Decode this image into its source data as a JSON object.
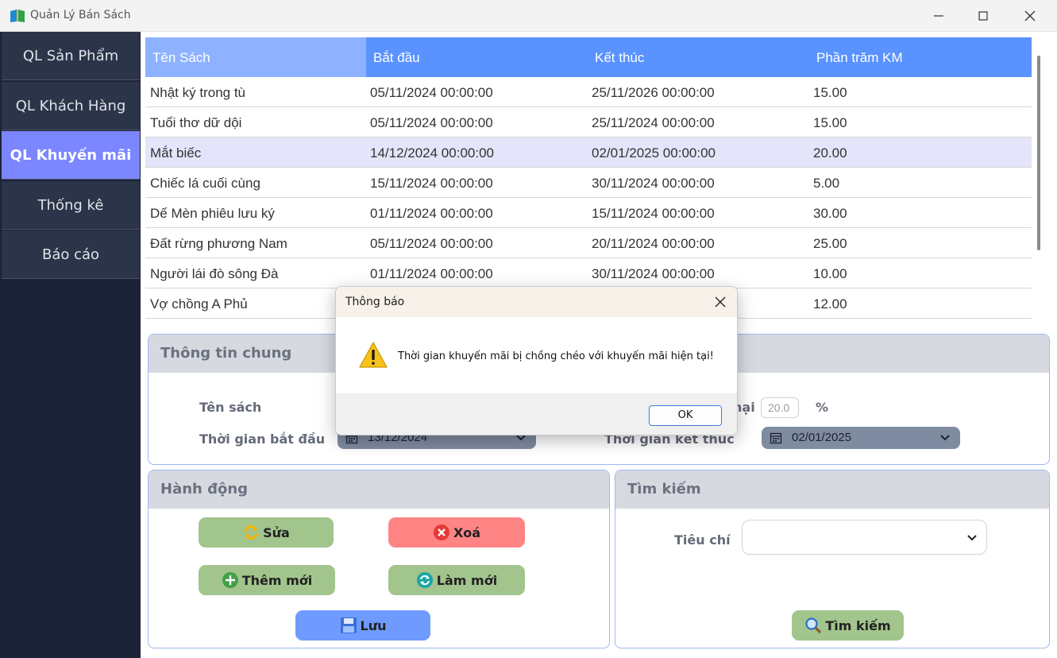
{
  "window": {
    "title": "Quản Lý Bán Sách"
  },
  "sidebar": {
    "items": [
      {
        "label": "QL Sản Phẩm",
        "active": false
      },
      {
        "label": "QL Khách Hàng",
        "active": false
      },
      {
        "label": "QL Khuyến mãi",
        "active": true
      },
      {
        "label": "Thống kê",
        "active": false
      },
      {
        "label": "Báo cáo",
        "active": false
      }
    ]
  },
  "table": {
    "columns": [
      "Tên Sách",
      "Bắt đầu",
      "Kết thúc",
      "Phần trăm KM"
    ],
    "rows": [
      [
        "Nhật ký trong tù",
        "05/11/2024 00:00:00",
        "25/11/2026 00:00:00",
        "15.00"
      ],
      [
        "Tuổi thơ dữ dội",
        "05/11/2024 00:00:00",
        "25/11/2024 00:00:00",
        "15.00"
      ],
      [
        "Mắt biếc",
        "14/12/2024 00:00:00",
        "02/01/2025 00:00:00",
        "20.00"
      ],
      [
        "Chiếc lá cuối cùng",
        "15/11/2024 00:00:00",
        "30/11/2024 00:00:00",
        "5.00"
      ],
      [
        "Dế Mèn phiêu lưu ký",
        "01/11/2024 00:00:00",
        "15/11/2024 00:00:00",
        "30.00"
      ],
      [
        "Đất rừng phương Nam",
        "05/11/2024 00:00:00",
        "20/11/2024 00:00:00",
        "25.00"
      ],
      [
        "Người lái đò sông Đà",
        "01/11/2024 00:00:00",
        "30/11/2024 00:00:00",
        "10.00"
      ],
      [
        "Vợ chồng A Phủ",
        "",
        "",
        "12.00"
      ]
    ],
    "selected_row": 2
  },
  "info": {
    "title": "Thông tin chung",
    "book_label": "Tên sách",
    "start_label": "Thời gian bắt đầu",
    "start_value": "13/12/2024",
    "end_label": "Thời gian kết thúc",
    "end_value": "02/01/2025",
    "discount_label_fragment": "hại",
    "discount_value": "20.0",
    "percent_sign": "%"
  },
  "actions": {
    "title": "Hành động",
    "edit": "Sửa",
    "delete": "Xoá",
    "add": "Thêm mới",
    "refresh": "Làm mới",
    "save": "Lưu"
  },
  "search": {
    "title": "Tìm kiếm",
    "criteria_label": "Tiêu chí",
    "criteria_value": "",
    "button": "Tìm kiếm"
  },
  "dialog": {
    "title": "Thông báo",
    "message": "Thời gian khuyến mãi bị chồng chéo với khuyến mãi hiện tại!",
    "ok": "OK"
  },
  "colors": {
    "sidebar": "#1b2338",
    "active_nav": "#7b86ff",
    "table_header": "#5a93ff",
    "green_button": "#a2c48d",
    "red_button": "#ff8585",
    "blue_button": "#6f9bff"
  },
  "icons": [
    "app-book-icon",
    "calendar-icon",
    "chevron-down-icon",
    "refresh-icon",
    "delete-x-icon",
    "add-plus-icon",
    "reload-icon",
    "save-disk-icon",
    "magnifier-icon",
    "warning-icon",
    "close-icon"
  ]
}
